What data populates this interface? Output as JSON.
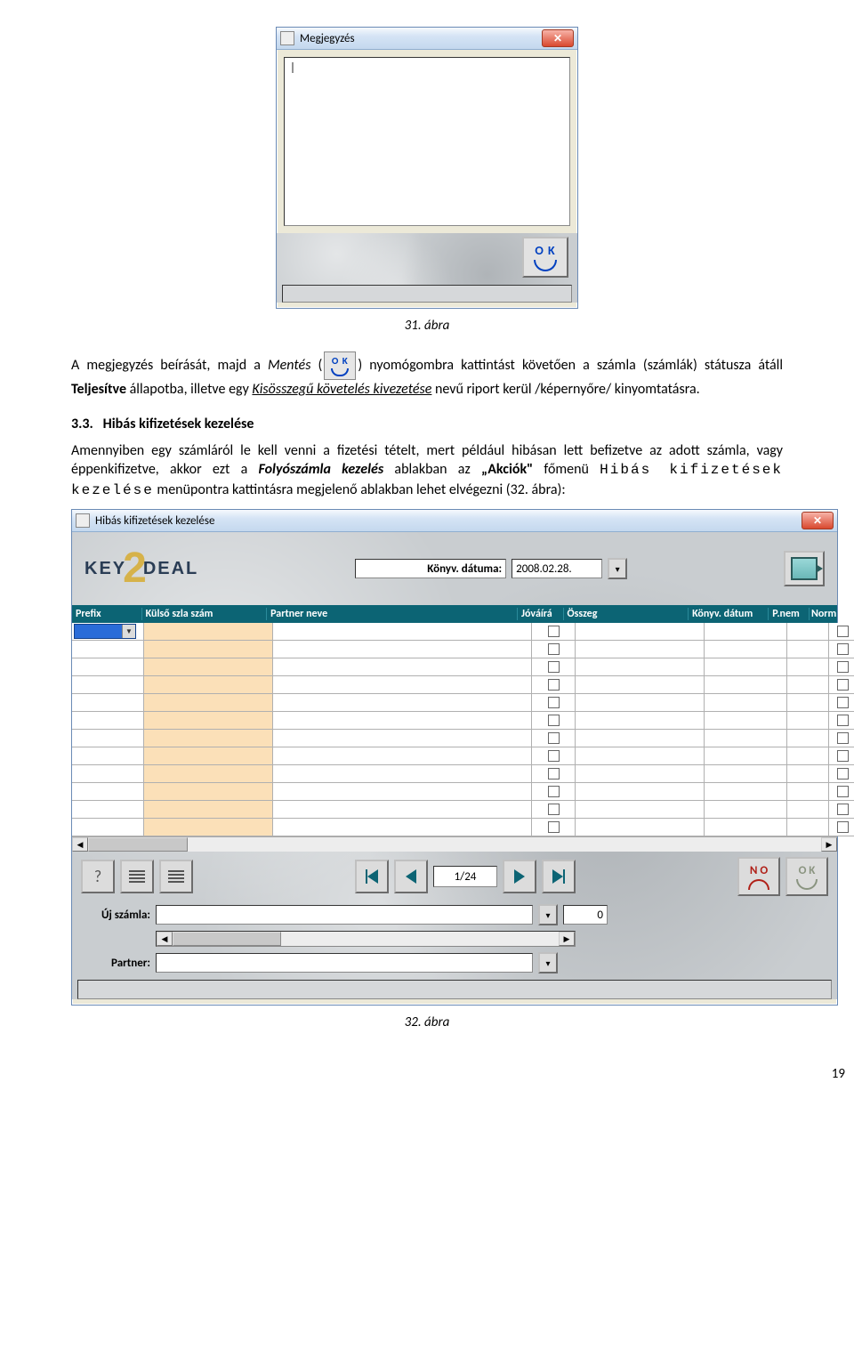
{
  "dialog1": {
    "title": "Megjegyzés",
    "close": "✕",
    "textarea_value": "|",
    "ok_label": "O K"
  },
  "caption1": "31. ábra",
  "inline_ok_label": "O K",
  "para1_a": "A megjegyzés beírását, majd a ",
  "para1_mentes": "Mentés",
  "para1_b": " (",
  "para1_c": ") nyomógombra kattintást követően a számla (számlák) státusza átáll ",
  "para1_teljes": "Teljesítve",
  "para1_d": " állapotba, illetve egy ",
  "para1_kis": "Kisösszegű követelés kivezetése",
  "para1_e": " nevű riport kerül /képernyőre/ kinyomtatásra.",
  "section_num": "3.3.",
  "section_title": "Hibás kifizetések kezelése",
  "para2_a": "Amennyiben egy számláról le kell venni a fizetési tételt, mert például hibásan lett befizetve az adott számla, vagy éppenkifizetve, akkor ezt a ",
  "para2_folyo": "Folyószámla kezelés",
  "para2_b": " ablakban az ",
  "para2_akciok": "„Akciók\"",
  "para2_c": " főmenü ",
  "para2_hibas": "Hibás kifizetések kezelése",
  "para2_d": " menüpontra kattintásra megjelenő ablakban lehet elvégezni (32. ábra):",
  "dialog2": {
    "title": "Hibás kifizetések kezelése",
    "close": "✕",
    "logo_key": "KEY",
    "logo_two": "2",
    "logo_deal": "DEAL",
    "date_label": "Könyv. dátuma:",
    "date_value": "2008.02.28.",
    "headers": {
      "prefix": "Prefix",
      "kulso": "Külső szla szám",
      "partner": "Partner neve",
      "jovair": "Jóváírá",
      "osszeg": "Összeg",
      "datum": "Könyv. dátum",
      "pnem": "P.nem",
      "norm": "Norm"
    },
    "nav": {
      "page": "1/24"
    },
    "uj_szamla_label": "Új számla:",
    "uj_szamla_zero": "0",
    "partner_label": "Partner:",
    "no_label": "N O",
    "ok_label": "O K"
  },
  "caption2": "32. ábra",
  "page_number": "19"
}
